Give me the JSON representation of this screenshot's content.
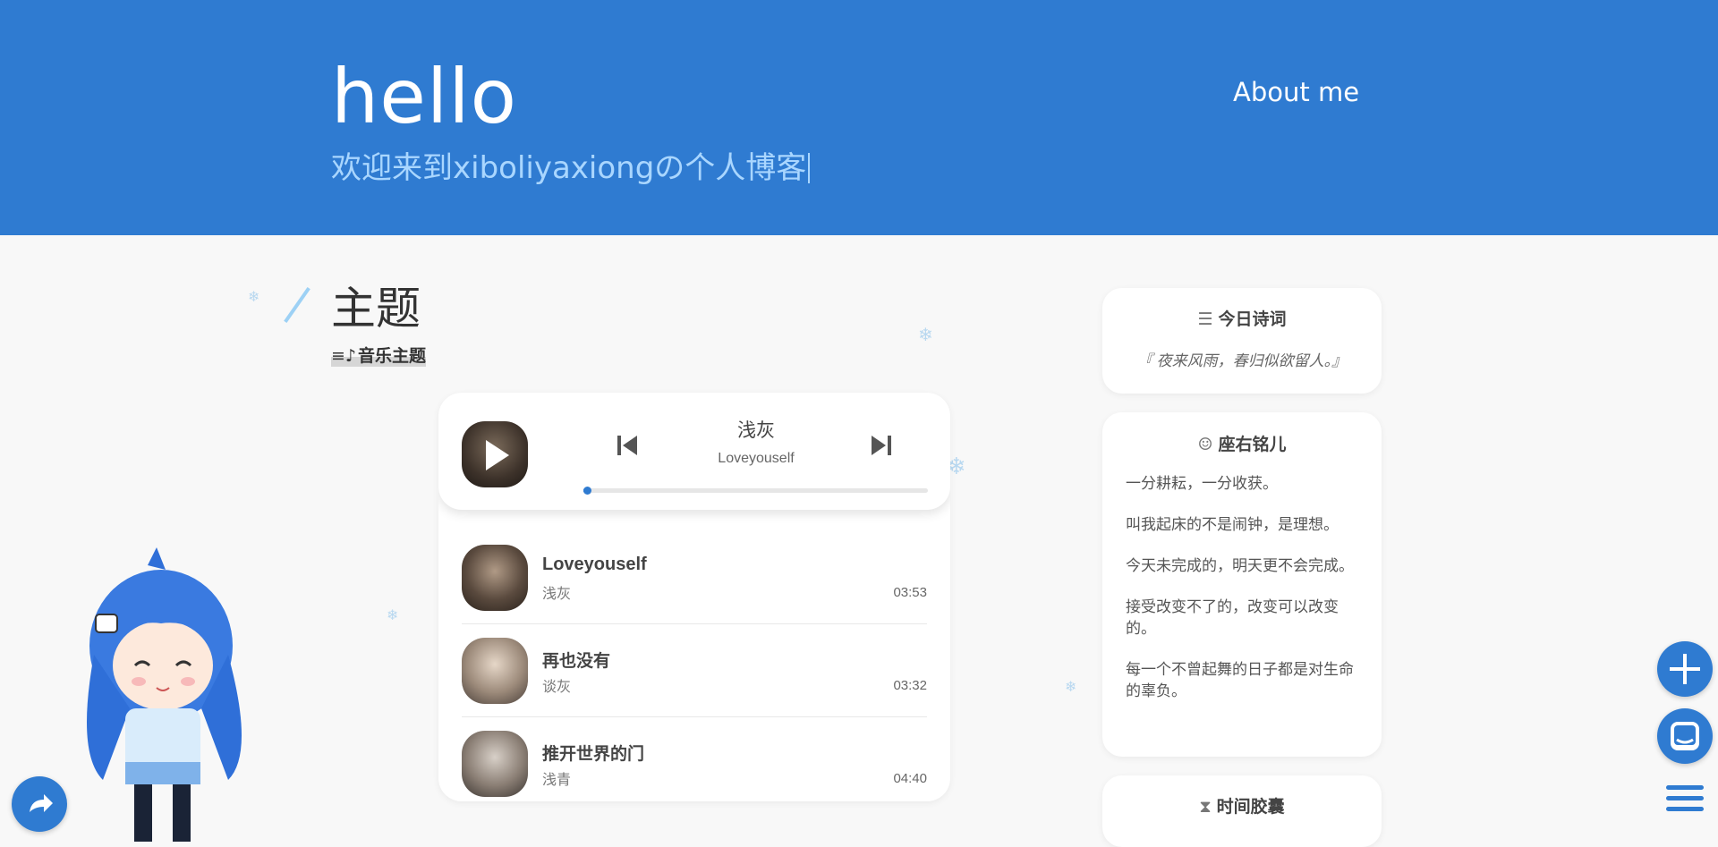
{
  "header": {
    "brand": "hello",
    "subtitle": "欢迎来到xiboliyaxiongの个人博客",
    "nav_about": "About me"
  },
  "section": {
    "title": "主题",
    "subtitle": "音乐主题",
    "subtitle_icon": "music-list-icon"
  },
  "player": {
    "now_playing": {
      "title": "浅灰",
      "artist": "Loveyouself"
    },
    "progress": 0.01,
    "colors": {
      "accent": "#2f7bd1"
    },
    "tracks": [
      {
        "title": "Loveyouself",
        "artist": "浅灰",
        "duration": "03:53"
      },
      {
        "title": "再也没有",
        "artist": "谈灰",
        "duration": "03:32"
      },
      {
        "title": "推开世界的门",
        "artist": "浅青",
        "duration": "04:40"
      }
    ]
  },
  "sidebar": {
    "poem": {
      "title": "今日诗词",
      "icon": "list-icon",
      "text": "『 夜来风雨，春归似欲留人。』"
    },
    "motto": {
      "title": "座右铭儿",
      "icon": "smile-icon",
      "items": [
        "一分耕耘，一分收获。",
        "叫我起床的不是闹钟，是理想。",
        "今天未完成的，明天更不会完成。",
        "接受改变不了的，改变可以改变的。",
        "每一个不曾起舞的日子都是对生命的辜负。"
      ]
    },
    "capsule": {
      "title": "时间胶囊",
      "icon": "hourglass-icon"
    }
  },
  "floating": {
    "share_icon": "share-icon",
    "add_icon": "plus-icon",
    "chat_icon": "chat-icon",
    "menu_icon": "menu-icon"
  },
  "colors": {
    "header_bg": "#2f7bd1",
    "subtitle": "#a9d6ff",
    "page_bg": "#f8f8f8"
  }
}
